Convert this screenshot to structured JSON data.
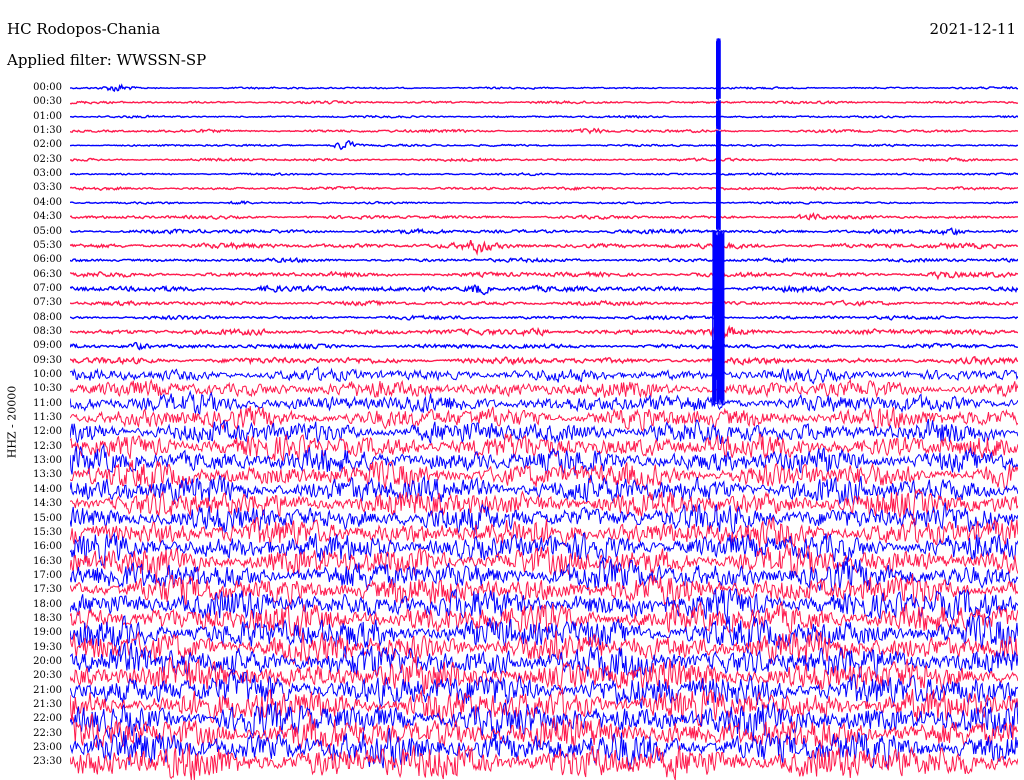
{
  "header": {
    "station": "HC Rodopos-Chania",
    "filter": "Applied filter: WWSSN-SP",
    "date": "2021-12-11"
  },
  "chart_data": {
    "type": "line",
    "title": "HC Rodopos-Chania",
    "ylabel": "HHZ - 20000",
    "date": "2021-12-11",
    "filter": "WWSSN-SP",
    "row_minutes": 30,
    "colors": [
      "#0000ff",
      "#ff1a4d"
    ],
    "rows": [
      {
        "label": "00:00",
        "noise": 0.9,
        "events": [
          {
            "t": 0.05,
            "amp": 4.5
          }
        ]
      },
      {
        "label": "00:30",
        "noise": 1.2,
        "events": []
      },
      {
        "label": "01:00",
        "noise": 1.0,
        "events": []
      },
      {
        "label": "01:30",
        "noise": 1.4,
        "events": [
          {
            "t": 0.55,
            "amp": 2.2
          }
        ]
      },
      {
        "label": "02:00",
        "noise": 1.0,
        "events": [
          {
            "t": 0.29,
            "amp": 6
          }
        ]
      },
      {
        "label": "02:30",
        "noise": 1.3,
        "events": []
      },
      {
        "label": "03:00",
        "noise": 1.0,
        "events": []
      },
      {
        "label": "03:30",
        "noise": 1.4,
        "events": []
      },
      {
        "label": "04:00",
        "noise": 1.0,
        "events": [
          {
            "t": 0.18,
            "amp": 2.5
          }
        ]
      },
      {
        "label": "04:30",
        "noise": 1.6,
        "events": [
          {
            "t": 0.78,
            "amp": 3
          }
        ]
      },
      {
        "label": "05:00",
        "noise": 2.0,
        "events": [
          {
            "t": 0.93,
            "amp": 4
          }
        ]
      },
      {
        "label": "05:30",
        "noise": 2.5,
        "events": [
          {
            "t": 0.43,
            "amp": 6
          }
        ]
      },
      {
        "label": "06:00",
        "noise": 1.8,
        "events": []
      },
      {
        "label": "06:30",
        "noise": 2.3,
        "events": [
          {
            "t": 0.92,
            "amp": 4
          }
        ]
      },
      {
        "label": "07:00",
        "noise": 2.6,
        "events": [
          {
            "t": 0.43,
            "amp": 7
          },
          {
            "t": 0.21,
            "amp": 3
          }
        ]
      },
      {
        "label": "07:30",
        "noise": 2.0,
        "events": []
      },
      {
        "label": "08:00",
        "noise": 1.8,
        "events": []
      },
      {
        "label": "08:30",
        "noise": 2.6,
        "events": [
          {
            "t": 0.49,
            "amp": 5
          },
          {
            "t": 0.69,
            "amp": 5
          }
        ]
      },
      {
        "label": "09:00",
        "noise": 2.2,
        "events": [
          {
            "t": 0.07,
            "amp": 4
          }
        ]
      },
      {
        "label": "09:30",
        "noise": 3.0,
        "events": []
      },
      {
        "label": "10:00",
        "noise": 6.0,
        "events": []
      },
      {
        "label": "10:30",
        "noise": 8.0,
        "events": []
      },
      {
        "label": "11:00",
        "noise": 9.0,
        "events": []
      },
      {
        "label": "11:30",
        "noise": 10.0,
        "events": []
      },
      {
        "label": "12:00",
        "noise": 11.0,
        "events": []
      },
      {
        "label": "12:30",
        "noise": 12.0,
        "events": []
      },
      {
        "label": "13:00",
        "noise": 12.0,
        "events": []
      },
      {
        "label": "13:30",
        "noise": 12.5,
        "events": []
      },
      {
        "label": "14:00",
        "noise": 13.0,
        "events": []
      },
      {
        "label": "14:30",
        "noise": 13.0,
        "events": []
      },
      {
        "label": "15:00",
        "noise": 13.0,
        "events": []
      },
      {
        "label": "15:30",
        "noise": 13.5,
        "events": []
      },
      {
        "label": "16:00",
        "noise": 13.5,
        "events": []
      },
      {
        "label": "16:30",
        "noise": 14.0,
        "events": []
      },
      {
        "label": "17:00",
        "noise": 14.0,
        "events": []
      },
      {
        "label": "17:30",
        "noise": 14.0,
        "events": []
      },
      {
        "label": "18:00",
        "noise": 14.5,
        "events": []
      },
      {
        "label": "18:30",
        "noise": 14.5,
        "events": []
      },
      {
        "label": "19:00",
        "noise": 15.0,
        "events": []
      },
      {
        "label": "19:30",
        "noise": 15.0,
        "events": []
      },
      {
        "label": "20:00",
        "noise": 15.5,
        "events": []
      },
      {
        "label": "20:30",
        "noise": 15.5,
        "events": []
      },
      {
        "label": "21:00",
        "noise": 16.0,
        "events": []
      },
      {
        "label": "21:30",
        "noise": 16.0,
        "events": []
      },
      {
        "label": "22:00",
        "noise": 16.0,
        "events": []
      },
      {
        "label": "22:30",
        "noise": 16.0,
        "events": []
      },
      {
        "label": "23:00",
        "noise": 16.5,
        "events": []
      },
      {
        "label": "23:30",
        "noise": 17.0,
        "events": []
      }
    ],
    "big_event": {
      "t": 0.684
    }
  }
}
